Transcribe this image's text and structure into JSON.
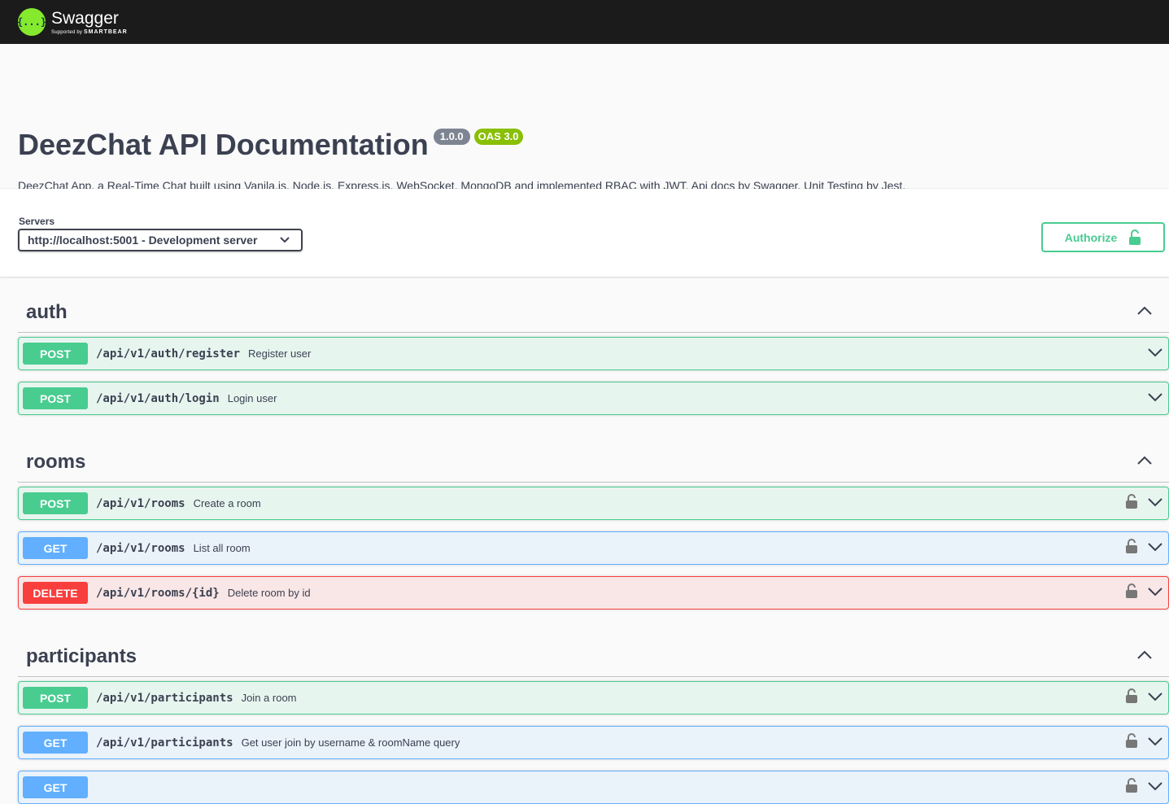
{
  "topbar": {
    "logo_name": "Swagger",
    "logo_supported": "Supported by",
    "logo_smartbear": "SMARTBEAR",
    "logo_glyph": "{...}"
  },
  "info": {
    "title": "DeezChat API Documentation",
    "version": "1.0.0",
    "oas": "OAS 3.0",
    "description": "DeezChat App, a Real-Time Chat built using Vanila.js, Node.js, Express.js, WebSocket, MongoDB and implemented RBAC with JWT, Api docs by Swagger, Unit Testing by Jest."
  },
  "servers": {
    "label": "Servers",
    "selected": "http://localhost:5001 - Development server"
  },
  "authorize": {
    "label": "Authorize"
  },
  "tags": [
    {
      "name": "auth",
      "operations": [
        {
          "method": "POST",
          "path": "/api/v1/auth/register",
          "summary": "Register user",
          "locked": false
        },
        {
          "method": "POST",
          "path": "/api/v1/auth/login",
          "summary": "Login user",
          "locked": false
        }
      ]
    },
    {
      "name": "rooms",
      "operations": [
        {
          "method": "POST",
          "path": "/api/v1/rooms",
          "summary": "Create a room",
          "locked": true
        },
        {
          "method": "GET",
          "path": "/api/v1/rooms",
          "summary": "List all room",
          "locked": true
        },
        {
          "method": "DELETE",
          "path": "/api/v1/rooms/{id}",
          "summary": "Delete room by id",
          "locked": true
        }
      ]
    },
    {
      "name": "participants",
      "operations": [
        {
          "method": "POST",
          "path": "/api/v1/participants",
          "summary": "Join a room",
          "locked": true
        },
        {
          "method": "GET",
          "path": "/api/v1/participants",
          "summary": "Get user join by username & roomName query",
          "locked": true
        },
        {
          "method": "GET",
          "path": "",
          "summary": "",
          "locked": true
        }
      ]
    }
  ],
  "colors": {
    "post": "#49cc90",
    "get": "#61affe",
    "delete": "#f93e3e",
    "topbar": "#1b1b1b",
    "logo": "#85ea2d"
  },
  "icons": {
    "chevron_up": "chevron-up-icon",
    "chevron_down": "chevron-down-icon",
    "lock": "lock-icon",
    "unlock": "unlock-icon"
  }
}
